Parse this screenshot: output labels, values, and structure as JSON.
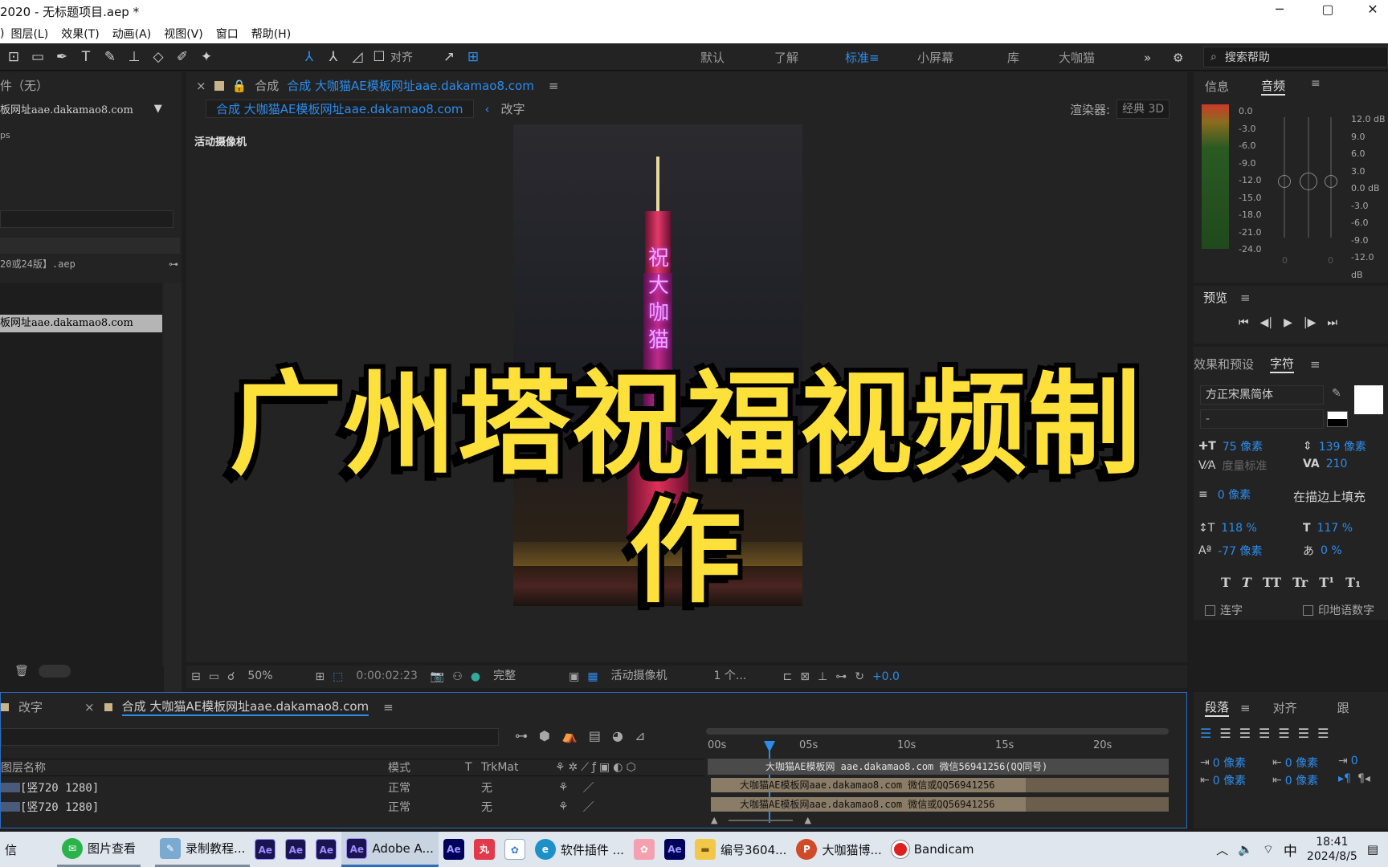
{
  "window": {
    "title": "2020 - 无标题项目.aep *",
    "controls": [
      "─",
      "▢",
      "✕"
    ]
  },
  "menu": [
    "图层(L)",
    "效果(T)",
    "动画(A)",
    "视图(V)",
    "窗口",
    "帮助(H)"
  ],
  "menu_prefix": ")",
  "toolbar": {
    "align_label": "对齐"
  },
  "workspaces": [
    {
      "label": "默认",
      "active": false
    },
    {
      "label": "了解",
      "active": false
    },
    {
      "label": "标准",
      "active": true
    },
    {
      "label": "小屏幕",
      "active": false
    },
    {
      "label": "库",
      "active": false
    },
    {
      "label": "大咖猫",
      "active": false
    }
  ],
  "search_help": "搜索帮助",
  "project": {
    "header": "件（无）",
    "comp_name": "板网址aae.dakamao8.com",
    "fps_fragment": "ps",
    "file_name": "20或24版】.aep",
    "selected_item": "板网址aae.dakamao8.com"
  },
  "comp_panel": {
    "tab_prefix": "合成",
    "tab_title": "合成 大咖猫AE模板网址aae.dakamao8.com",
    "subtab_active": "合成 大咖猫AE模板网址aae.dakamao8.com",
    "subtab_other": "改字",
    "renderer_label": "渲染器:",
    "renderer_value": "经典 3D",
    "camera_label": "活动摄像机"
  },
  "video_text": "祝大咖猫",
  "overlay_title": "广州塔祝福视频制作",
  "viewer_footer": {
    "zoom": "50%",
    "timecode": "0:00:02:23",
    "quality": "完整",
    "camera": "活动摄像机",
    "views": "1 个...",
    "exposure": "+0.0"
  },
  "info_panel": {
    "tab_info": "信息",
    "tab_audio": "音频"
  },
  "audio": {
    "left_scale": [
      "0.0",
      "-3.0",
      "-6.0",
      "-9.0",
      "-12.0",
      "-15.0",
      "-18.0",
      "-21.0",
      "-24.0"
    ],
    "right_scale": [
      "12.0 dB",
      "9.0",
      "6.0",
      "3.0",
      "0.0 dB",
      "-3.0",
      "-6.0",
      "-9.0",
      "-12.0 dB"
    ],
    "zero_left": "0",
    "zero_right": "0"
  },
  "preview": {
    "title": "预览"
  },
  "character": {
    "tab_effects": "效果和预设",
    "tab_char": "字符",
    "font_family": "方正宋黑简体",
    "font_style": "-",
    "size": "75 像素",
    "leading": "139 像素",
    "kerning": "度量标准",
    "tracking": "210",
    "stroke": "0 像素",
    "stroke_mode": "在描边上填充",
    "vscale": "118 %",
    "hscale": "117 %",
    "baseline": "-77 像素",
    "tsume": "0 %",
    "style_buttons": [
      "T",
      "T",
      "TT",
      "Tr",
      "T¹",
      "T₁"
    ],
    "ligature_label": "连字",
    "hindi_label": "印地语数字"
  },
  "paragraph": {
    "tab_para": "段落",
    "tab_align": "对齐",
    "tab_track": "跟",
    "fields": [
      "0 像素",
      "0 像素",
      "0 像素",
      "0 像素",
      "0 像素",
      "0"
    ]
  },
  "timeline": {
    "tab_other": "改字",
    "tab_active": "合成 大咖猫AE模板网址aae.dakamao8.com",
    "col_layer_name": "图层名称",
    "col_mode": "模式",
    "col_t": "T",
    "col_trkmat": "TrkMat",
    "ruler": [
      "00s",
      "05s",
      "10s",
      "15s",
      "20s"
    ],
    "layers": [
      {
        "name": "[竖720 1280]",
        "mode": "正常",
        "trkmat": "无"
      },
      {
        "name": "[竖720 1280]",
        "mode": "正常",
        "trkmat": "无"
      }
    ],
    "bars": [
      "大咖猫AE模板网 aae.dakamao8.com  微信56941256(QQ同号)",
      "大咖猫AE模板网aae.dakamao8.com  微信或QQ56941256",
      "大咖猫AE模板网aae.dakamao8.com  微信或QQ56941256"
    ]
  },
  "taskbar": {
    "items": [
      {
        "label": "信",
        "icon": ""
      },
      {
        "label": "图片查看",
        "icon": "wechat-icon"
      },
      {
        "label": "录制教程...",
        "icon": "note-icon"
      },
      {
        "label": "",
        "icon": "Ae"
      },
      {
        "label": "",
        "icon": "Ae"
      },
      {
        "label": "",
        "icon": "Ae"
      },
      {
        "label": "Adobe A...",
        "icon": "Ae"
      },
      {
        "label": "",
        "icon": "Ae"
      },
      {
        "label": "",
        "icon": "丸"
      },
      {
        "label": "",
        "icon": "app-icon"
      },
      {
        "label": "软件插件 ...",
        "icon": "edge-icon"
      },
      {
        "label": "",
        "icon": "paint-icon"
      },
      {
        "label": "",
        "icon": "Ae"
      },
      {
        "label": "编号3604...",
        "icon": "folder-icon"
      },
      {
        "label": "大咖猫博...",
        "icon": "P"
      },
      {
        "label": "Bandicam",
        "icon": "record-icon"
      }
    ],
    "ime": "中",
    "time": "18:41",
    "date": "2024/8/5"
  }
}
